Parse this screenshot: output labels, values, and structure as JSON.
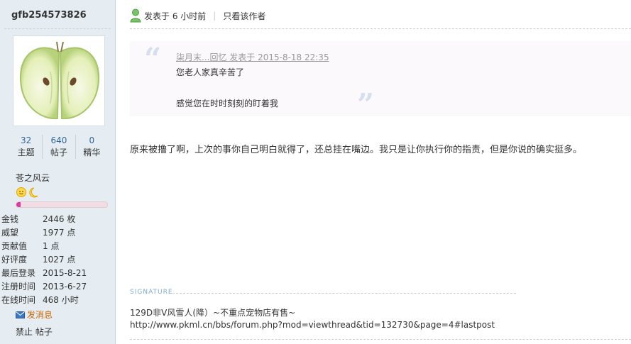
{
  "user": {
    "name": "gfb254573826",
    "avatar": "apple-halves-image",
    "stats": [
      {
        "value": "32",
        "label": "主题"
      },
      {
        "value": "640",
        "label": "帖子"
      },
      {
        "value": "0",
        "label": "精华"
      }
    ],
    "group": "苍之风云",
    "rank_icons": [
      "sun-icon",
      "moon-icon"
    ],
    "progress": 0.05,
    "info": [
      {
        "key": "金钱",
        "value": "2446 枚"
      },
      {
        "key": "威望",
        "value": "1977 点"
      },
      {
        "key": "贡献值",
        "value": "1 点"
      },
      {
        "key": "好评度",
        "value": "1027 点"
      },
      {
        "key": "最后登录",
        "value": "2015-8-21"
      },
      {
        "key": "注册时间",
        "value": "2013-6-27"
      },
      {
        "key": "在线时间",
        "value": "468 小时"
      }
    ],
    "send_message": "发消息",
    "ban": "禁止 帖子"
  },
  "post": {
    "posted": "发表于 6 小时前",
    "only_author": "只看该作者",
    "quote": {
      "author": "柒月末...回忆 发表于 2015-8-18 22:35",
      "line1": "您老人家真辛苦了",
      "line2": "感觉您在时时刻刻的盯着我"
    },
    "body": "原来被撸了啊，上次的事你自己明白就得了，还总挂在嘴边。我只是让你执行你的指责，但是你说的确实挺多。",
    "signature_label": "SIGNATURE",
    "signature_line1": "129D非V风雪人(降）~不重点宠物店有售~",
    "signature_line2": "http://www.pkml.cn/bbs/forum.php?mod=viewthread&tid=132730&page=4#lastpost"
  },
  "colors": {
    "accent": "#336699",
    "panel_bg": "#e5edf2",
    "progress": "#d93ba0"
  }
}
